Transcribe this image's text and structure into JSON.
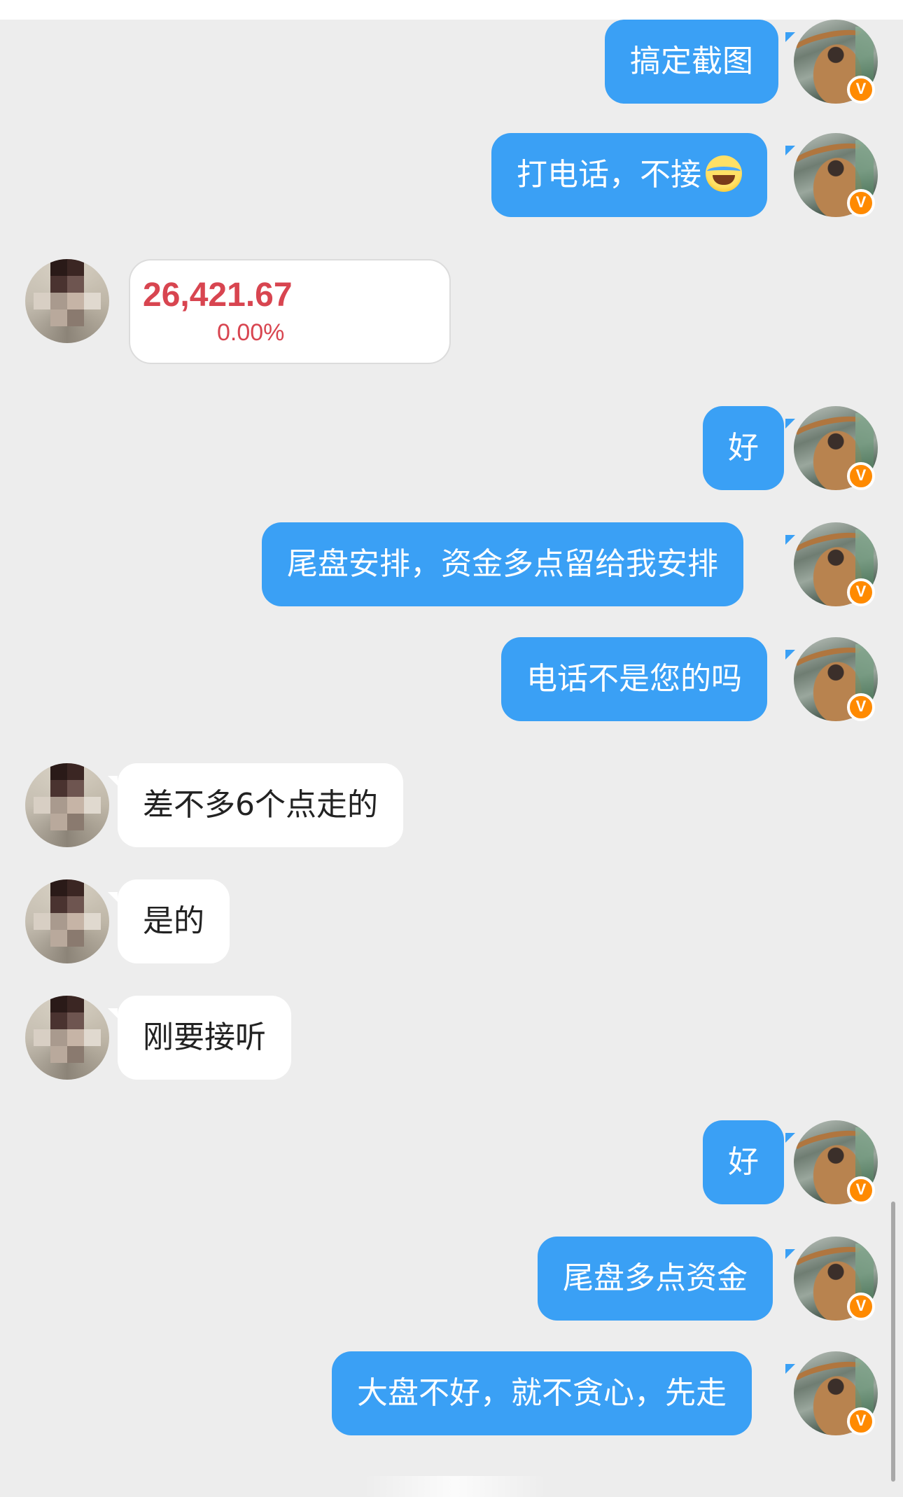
{
  "messages": [
    {
      "side": "out",
      "text": "搞定截图"
    },
    {
      "side": "out",
      "text": "打电话，不接",
      "emoji": "laughing-tears-emoji"
    },
    {
      "side": "in",
      "type": "stock-card",
      "value": "26,421.67",
      "change": "0.00%"
    },
    {
      "side": "out",
      "text": "好"
    },
    {
      "side": "out",
      "text": "尾盘安排，资金多点留给我安排"
    },
    {
      "side": "out",
      "text": "电话不是您的吗"
    },
    {
      "side": "in",
      "text": "差不多6个点走的"
    },
    {
      "side": "in",
      "text": "是的"
    },
    {
      "side": "in",
      "text": "刚要接听"
    },
    {
      "side": "out",
      "text": "好"
    },
    {
      "side": "out",
      "text": "尾盘多点资金"
    },
    {
      "side": "out",
      "text": "大盘不好，就不贪心，先走"
    }
  ],
  "badge": "V",
  "colors": {
    "outgoing": "#3aa0f5",
    "incoming": "#ffffff",
    "background": "#ededed",
    "stock": "#d84550",
    "badge": "#ff8a00"
  }
}
